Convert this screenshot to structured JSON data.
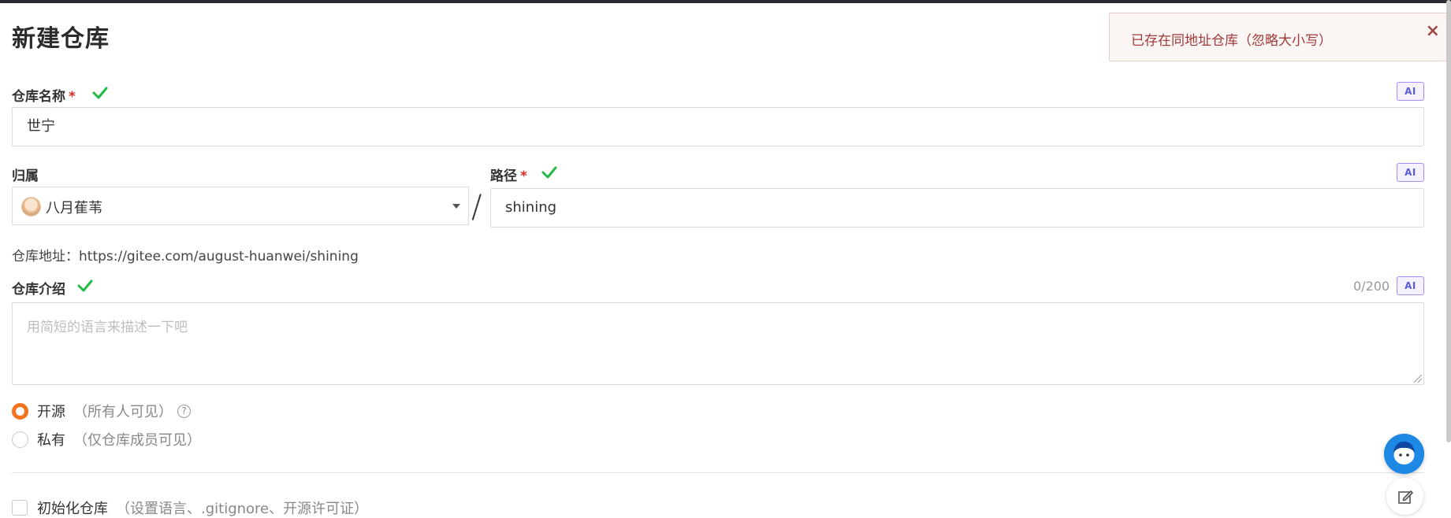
{
  "page": {
    "title": "新建仓库"
  },
  "flash": {
    "message": "已存在同地址仓库（忽略大小写）",
    "close": "×"
  },
  "repo_name": {
    "label": "仓库名称",
    "required_mark": "*",
    "value": "世宁",
    "ai_label": "AI"
  },
  "owner": {
    "label": "归属",
    "selected": "八月萑苇"
  },
  "separator": "/",
  "path": {
    "label": "路径",
    "required_mark": "*",
    "value": "shining",
    "ai_label": "AI"
  },
  "repo_url": {
    "text": "仓库地址：https://gitee.com/august-huanwei/shining"
  },
  "description": {
    "label": "仓库介绍",
    "counter": "0/200",
    "placeholder": "用简短的语言来描述一下吧",
    "ai_label": "AI"
  },
  "visibility": {
    "public": {
      "label": "开源",
      "hint": "（所有人可见）",
      "help": "?"
    },
    "private": {
      "label": "私有",
      "hint": "（仅仓库成员可见）"
    }
  },
  "init": {
    "label": "初始化仓库",
    "hint": "（设置语言、.gitignore、开源许可证）"
  },
  "colors": {
    "accent": "#f4731c",
    "valid": "#21ba45",
    "error_text": "#9f3a38",
    "ai": "#5b5fd6"
  },
  "icons": {
    "check": "check-icon",
    "close": "close-icon",
    "caret": "caret-down-icon",
    "help": "help-icon",
    "edit": "edit-icon"
  }
}
